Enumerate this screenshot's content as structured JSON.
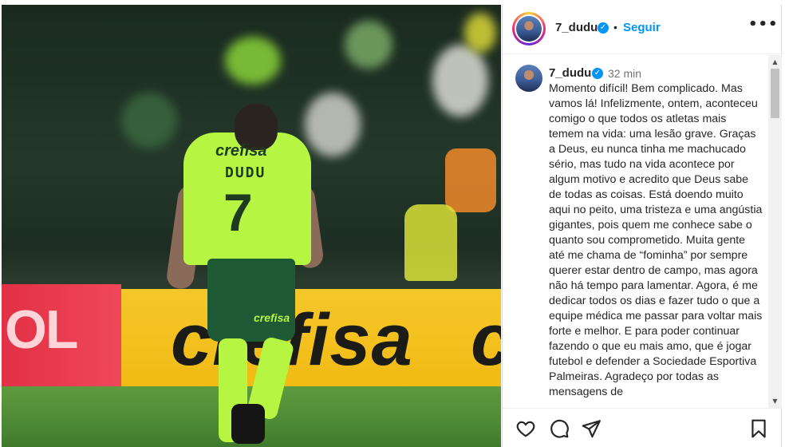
{
  "post": {
    "image": {
      "description_icon": "player-photo",
      "hoarding_left_text": "OL",
      "hoarding_right_text": "crefisa",
      "hoarding_right_text2": "c",
      "shirt_sponsor": "crefisa",
      "shirt_name": "DUDU",
      "shirt_number": "7",
      "shorts_sponsor": "crefisa"
    },
    "header": {
      "username": "7_dudu",
      "verified_icon": "verified-badge-icon",
      "separator": "•",
      "follow_label": "Seguir",
      "more_icon": "more-options-icon",
      "more_glyph": "•••"
    },
    "caption": {
      "username": "7_dudu",
      "time": "32 min",
      "text": "Momento difícil! Bem complicado. Mas vamos lá! Infelizmente, ontem, aconteceu comigo o que todos os atletas mais temem na vida: uma lesão grave. Graças a Deus, eu nunca tinha me machucado sério, mas tudo na vida acontece por algum motivo e acredito que Deus sabe de todas as coisas. Está doendo muito aqui no peito, uma tristeza e uma angústia gigantes, pois quem me conhece sabe o quanto sou comprometido. Muita gente até me chama de “fominha” por sempre querer estar dentro de campo, mas agora não há tempo para lamentar. Agora, é me dedicar todos os dias e fazer tudo o que a equipe médica me passar para voltar mais forte e melhor. E para poder continuar fazendo o que eu mais amo, que é jogar futebol e defender a Sociedade Esportiva Palmeiras. Agradeço por todas as mensagens de"
    },
    "scrollbar": {
      "up_glyph": "▲",
      "down_glyph": "▼"
    },
    "actions": {
      "like_icon": "heart-icon",
      "comment_icon": "comment-icon",
      "share_icon": "share-icon",
      "save_icon": "bookmark-icon"
    }
  }
}
